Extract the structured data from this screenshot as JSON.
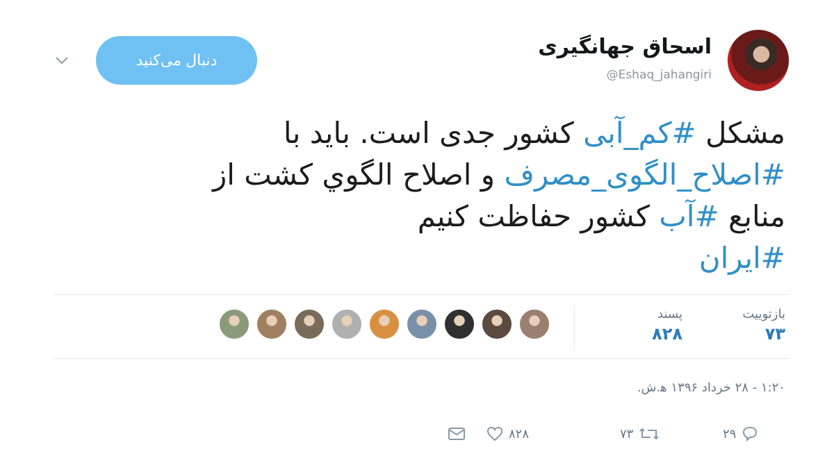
{
  "profile": {
    "display_name": "اسحاق جهانگیری",
    "handle": "@Eshaq_jahangiri"
  },
  "header": {
    "follow_label": "دنبال می‌کنید"
  },
  "tweet": {
    "lines": [
      [
        {
          "text": "مشکل ",
          "hashtag": false
        },
        {
          "text": "#کم_آبی",
          "hashtag": true
        },
        {
          "text": " کشور جدی است. باید با",
          "hashtag": false
        }
      ],
      [
        {
          "text": "#اصلاح_الگوی_مصرف",
          "hashtag": true
        },
        {
          "text": " و اصلاح الگوي كشت از",
          "hashtag": false
        }
      ],
      [
        {
          "text": "منابع ",
          "hashtag": false
        },
        {
          "text": "#آب",
          "hashtag": true
        },
        {
          "text": " کشور حفاظت کنیم",
          "hashtag": false
        }
      ],
      [
        {
          "text": "#ایران",
          "hashtag": true
        }
      ]
    ],
    "hashtag_color": "#2f8fc8"
  },
  "stats": {
    "retweets_label": "بازتوییت",
    "retweets_value": "۷۳",
    "likes_label": "پسند",
    "likes_value": "۸۲۸",
    "value_color": "#2b7bb9"
  },
  "likers": {
    "avatar_colors": [
      "#8a9a7a",
      "#a08060",
      "#7a6a5a",
      "#b0b0b0",
      "#d89040",
      "#7a90a8",
      "#303030",
      "#5a4a40",
      "#9a8070"
    ]
  },
  "timestamp": "۱:۲۰ - ۲۸ خرداد ۱۳۹۶ ه‍.ش.",
  "actions": {
    "reply_count": "۲۹",
    "retweet_count": "۷۳",
    "like_count": "۸۲۸",
    "icons": [
      "reply-icon",
      "retweet-icon",
      "heart-icon",
      "envelope-icon"
    ]
  },
  "colors": {
    "follow_button": "#6ec1f2",
    "secondary_text": "#657786"
  }
}
